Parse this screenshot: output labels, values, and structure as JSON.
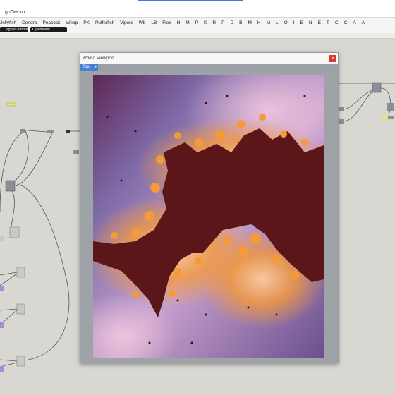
{
  "app": {
    "title": "…ghGecko"
  },
  "tabs": [
    "Jellyfish",
    "Dendro",
    "Peacock",
    "Weap",
    "PK",
    "Pufferfish",
    "Vipers",
    "Wb",
    "LB",
    "Flex",
    "H",
    "M",
    "P",
    "K",
    "R",
    "P",
    "D",
    "B",
    "M",
    "H",
    "M",
    "L",
    "Q",
    "I",
    "E",
    "N",
    "E",
    "T",
    "C",
    "C",
    "A",
    "A"
  ],
  "toolbar": {
    "chip1": "…ughyCompone…",
    "chip2": "OpenNest"
  },
  "viewport": {
    "title": "Rhino Viewport",
    "close": "×",
    "tab": "Top",
    "tab_caret": "▾"
  },
  "colors": {
    "canvas": "#d8d7d2",
    "fractal_dark": "#5a1618",
    "fractal_orange": "#f59a3a",
    "fractal_purple": "#7e6aa8",
    "fractal_deep": "#5c2855"
  }
}
